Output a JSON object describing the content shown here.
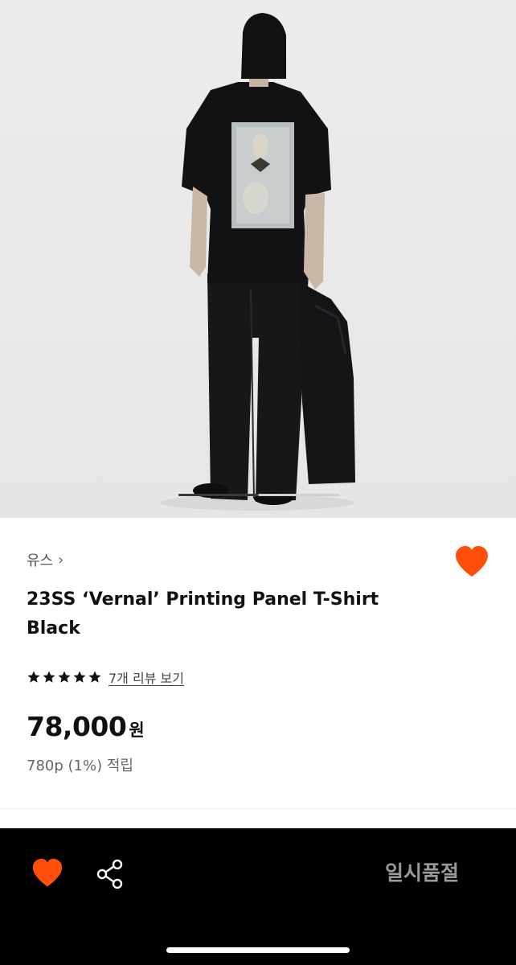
{
  "product": {
    "image_alt": "product photo",
    "brand": "유스",
    "brand_chevron": "›",
    "title": "23SS ‘Vernal’ Printing Panel T-Shirt Black",
    "rating": 5,
    "review_link": "7개 리뷰 보기",
    "price": "78,000",
    "currency": "원",
    "points": "780p (1%) 적립",
    "carousel_progress": 0.5
  },
  "bottom_bar": {
    "wishlist_icon": "heart-icon",
    "share_icon": "share-icon",
    "status_button": "일시품절"
  },
  "colors": {
    "accent": "#ff4f0a",
    "bottom_bar": "#000000",
    "sold_out_text": "#9a9a9a"
  }
}
